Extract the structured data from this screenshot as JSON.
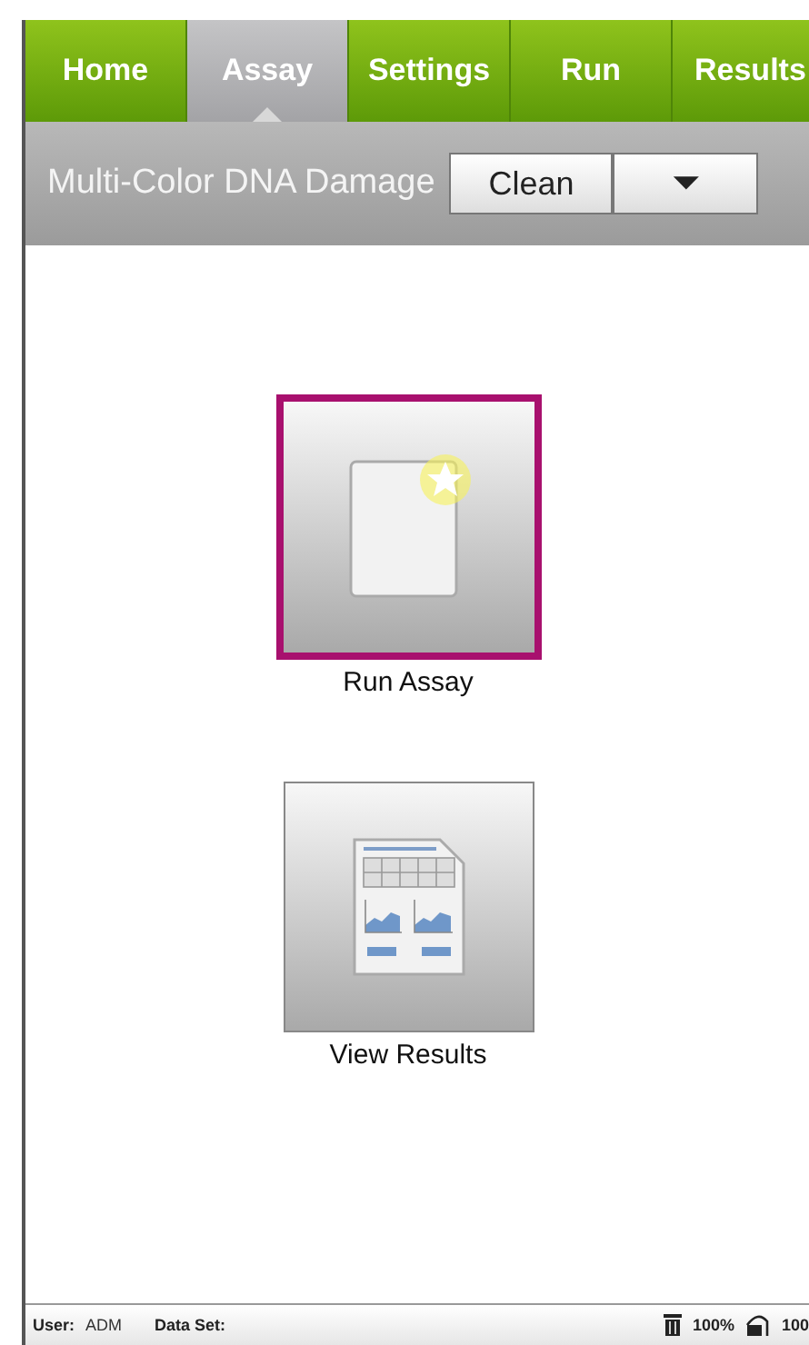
{
  "tabs": [
    {
      "label": "Home",
      "selected": false
    },
    {
      "label": "Assay",
      "selected": true
    },
    {
      "label": "Settings",
      "selected": false
    },
    {
      "label": "Run",
      "selected": false
    },
    {
      "label": "Results",
      "selected": false
    }
  ],
  "toolbar": {
    "title": "Multi-Color DNA Damage",
    "button": "Clean",
    "menu_glyph": "⏷"
  },
  "tiles": [
    {
      "kind": "new",
      "label": "Run Assay",
      "selected": true
    },
    {
      "kind": "results",
      "label": "View Results",
      "selected": false
    }
  ],
  "status_bar": {
    "user_label": "User:",
    "user": "ADM",
    "dataset_label": "Data Set:",
    "waste": "100%",
    "supply": "100"
  }
}
